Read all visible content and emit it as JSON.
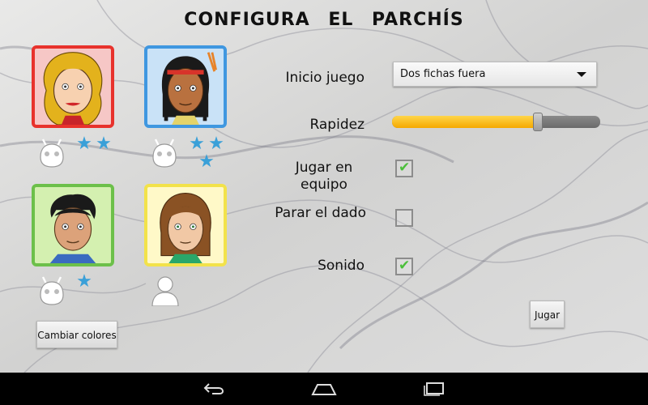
{
  "title": "CONFIGURA EL PARCHÍS",
  "players": [
    {
      "name": "jugador-1",
      "border": "#e8322c",
      "type": "robot",
      "stars": 2
    },
    {
      "name": "jugador-2",
      "border": "#3f97e0",
      "type": "robot",
      "stars": 3
    },
    {
      "name": "jugador-3",
      "border": "#6cc04a",
      "type": "robot",
      "stars": 1
    },
    {
      "name": "jugador-4",
      "border": "#f2e24a",
      "type": "human",
      "stars": 0
    }
  ],
  "settings": {
    "inicio_label": "Inicio juego",
    "inicio_value": "Dos fichas fuera",
    "rapidez_label": "Rapidez",
    "rapidez_value": 0.7,
    "equipo_label_1": "Jugar en",
    "equipo_label_2": "equipo",
    "equipo_checked": true,
    "parar_label": "Parar el dado",
    "parar_checked": false,
    "sonido_label": "Sonido",
    "sonido_checked": true
  },
  "buttons": {
    "cambiar": "Cambiar colores",
    "jugar": "Jugar"
  },
  "colors": {
    "slider_fill": "#f5b400",
    "star": "#3aa0d8",
    "check": "#4bbf3a"
  },
  "icons": {
    "robot": "robot-icon",
    "human": "person-icon",
    "star": "star-icon",
    "back": "back-icon",
    "home": "home-icon",
    "recents": "recents-icon"
  }
}
